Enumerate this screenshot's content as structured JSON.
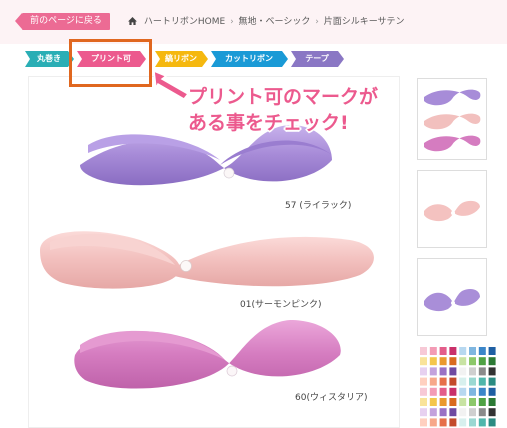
{
  "nav": {
    "back_label": "前のページに戻る",
    "breadcrumb": [
      "ハートリボンHOME",
      "無地・ベーシック",
      "片面シルキーサテン"
    ]
  },
  "tags": [
    {
      "label": "丸巻き",
      "color": "#2aaeb5"
    },
    {
      "label": "プリント可",
      "color": "#ec5a8e"
    },
    {
      "label": "縞リボン",
      "color": "#f5b80f"
    },
    {
      "label": "カットリボン",
      "color": "#1a9ad6"
    },
    {
      "label": "テープ",
      "color": "#8a77c4"
    }
  ],
  "callout": {
    "line1": "プリント可のマークが",
    "line2": "ある事をチェック!"
  },
  "products": [
    {
      "label": "57 (ライラック)",
      "color": "#a98ed8"
    },
    {
      "label": "01(サーモンピンク)",
      "color": "#f4c2c0"
    },
    {
      "label": "60(ウィスタリア)",
      "color": "#d77bc0"
    }
  ],
  "colors": {
    "highlight": "#e0671f",
    "accent": "#ec5a8e"
  }
}
